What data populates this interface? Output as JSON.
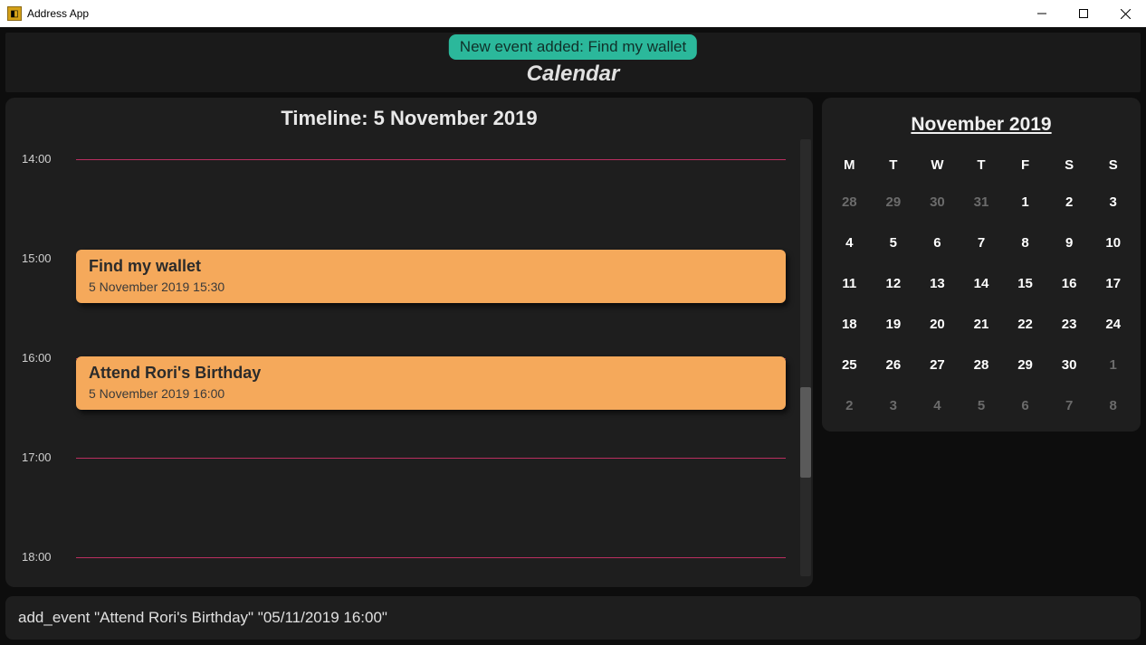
{
  "window": {
    "title": "Address App"
  },
  "toast": {
    "message": "New event added: Find my wallet"
  },
  "page": {
    "title": "Calendar"
  },
  "timeline": {
    "title": "Timeline: 5 November 2019",
    "hours": [
      "14:00",
      "15:00",
      "16:00",
      "17:00",
      "18:00"
    ],
    "events": [
      {
        "title": "Find my wallet",
        "sub": "5 November 2019 15:30"
      },
      {
        "title": "Attend Rori's Birthday",
        "sub": "5 November 2019 16:00"
      }
    ]
  },
  "calendar": {
    "title": "November 2019",
    "dow": [
      "M",
      "T",
      "W",
      "T",
      "F",
      "S",
      "S"
    ],
    "cells": [
      {
        "d": "28",
        "o": true
      },
      {
        "d": "29",
        "o": true
      },
      {
        "d": "30",
        "o": true
      },
      {
        "d": "31",
        "o": true
      },
      {
        "d": "1"
      },
      {
        "d": "2"
      },
      {
        "d": "3"
      },
      {
        "d": "4"
      },
      {
        "d": "5",
        "sel": true
      },
      {
        "d": "6"
      },
      {
        "d": "7"
      },
      {
        "d": "8"
      },
      {
        "d": "9"
      },
      {
        "d": "10"
      },
      {
        "d": "11"
      },
      {
        "d": "12"
      },
      {
        "d": "13"
      },
      {
        "d": "14"
      },
      {
        "d": "15"
      },
      {
        "d": "16"
      },
      {
        "d": "17",
        "today": true
      },
      {
        "d": "18"
      },
      {
        "d": "19"
      },
      {
        "d": "20"
      },
      {
        "d": "21"
      },
      {
        "d": "22"
      },
      {
        "d": "23"
      },
      {
        "d": "24"
      },
      {
        "d": "25"
      },
      {
        "d": "26"
      },
      {
        "d": "27"
      },
      {
        "d": "28"
      },
      {
        "d": "29"
      },
      {
        "d": "30"
      },
      {
        "d": "1",
        "o": true
      },
      {
        "d": "2",
        "o": true
      },
      {
        "d": "3",
        "o": true
      },
      {
        "d": "4",
        "o": true
      },
      {
        "d": "5",
        "o": true
      },
      {
        "d": "6",
        "o": true
      },
      {
        "d": "7",
        "o": true
      },
      {
        "d": "8",
        "o": true
      }
    ]
  },
  "command": {
    "value": "add_event \"Attend Rori's Birthday\" \"05/11/2019 16:00\""
  },
  "colors": {
    "accent": "#f5a95b",
    "toast": "#2bb89b",
    "line": "#d6336c"
  }
}
